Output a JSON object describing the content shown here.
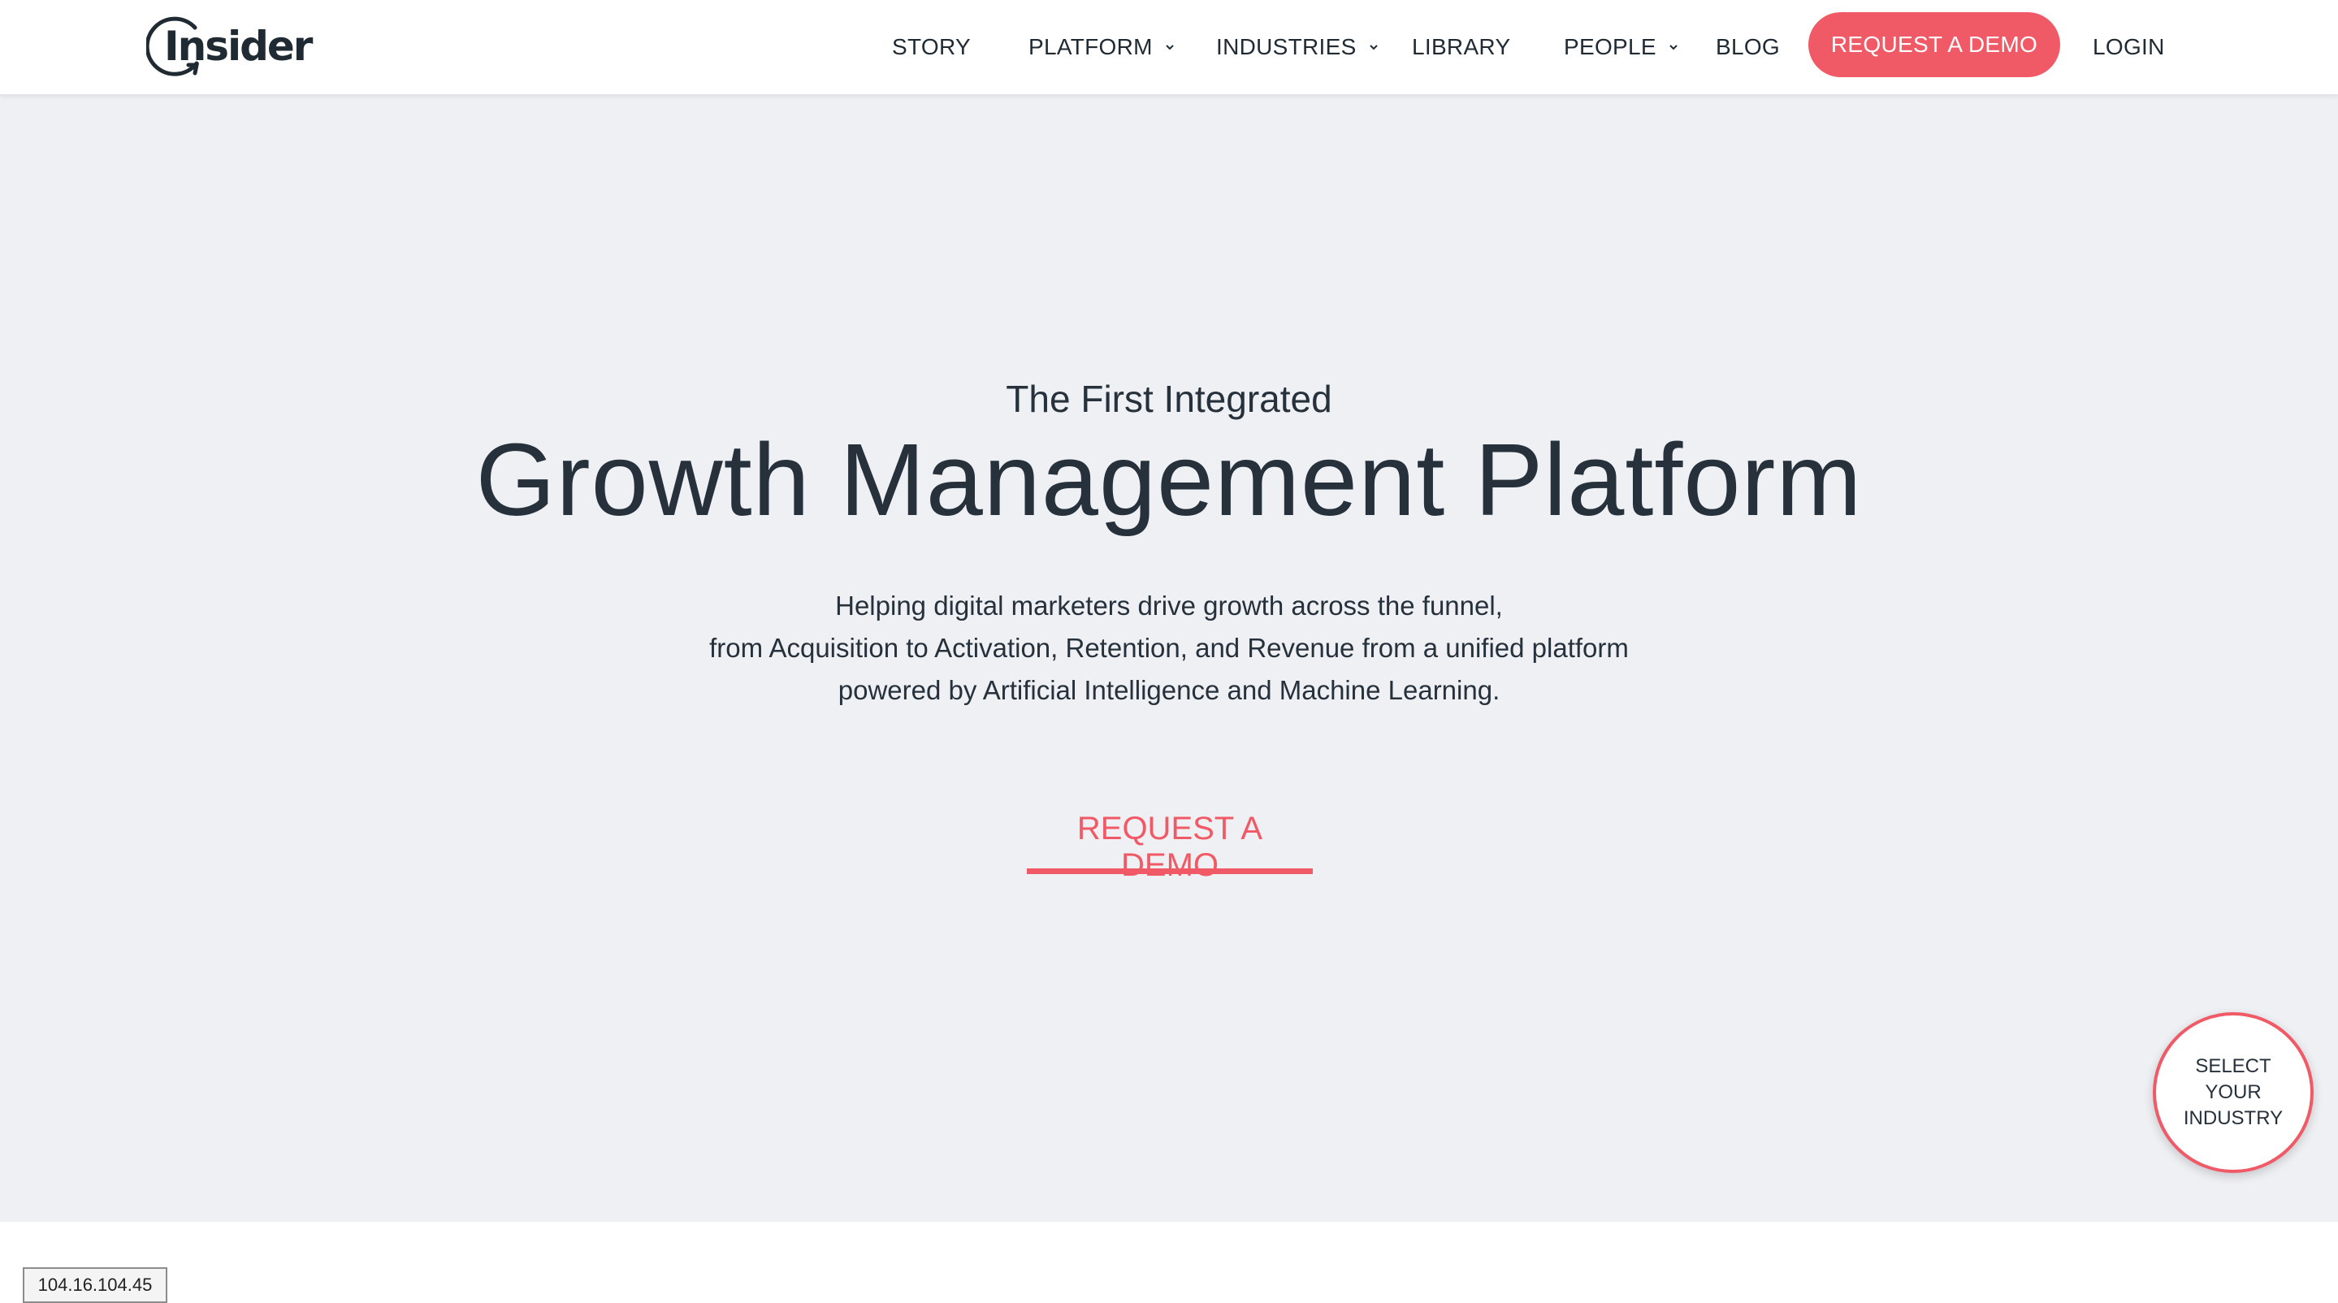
{
  "brand": {
    "logo_text": "Insider",
    "accent_color": "#f05a66",
    "text_color": "#26313b"
  },
  "nav": {
    "items": [
      {
        "label": "STORY",
        "dropdown": false
      },
      {
        "label": "PLATFORM",
        "dropdown": true
      },
      {
        "label": "INDUSTRIES",
        "dropdown": true
      },
      {
        "label": "LIBRARY",
        "dropdown": false
      },
      {
        "label": "PEOPLE",
        "dropdown": true
      },
      {
        "label": "BLOG",
        "dropdown": false
      }
    ],
    "demo_button": "REQUEST A DEMO",
    "login": "LOGIN"
  },
  "hero": {
    "eyebrow": "The First Integrated",
    "headline": "Growth Management Platform",
    "subtitle_lines": [
      "Helping digital marketers drive growth across the funnel,",
      "from Acquisition to Activation, Retention, and Revenue from a unified platform",
      "powered by Artificial Intelligence and Machine Learning."
    ],
    "cta": "REQUEST A DEMO"
  },
  "industry_selector": {
    "lines": [
      "SELECT",
      "YOUR",
      "INDUSTRY"
    ]
  },
  "ip_badge": "104.16.104.45"
}
